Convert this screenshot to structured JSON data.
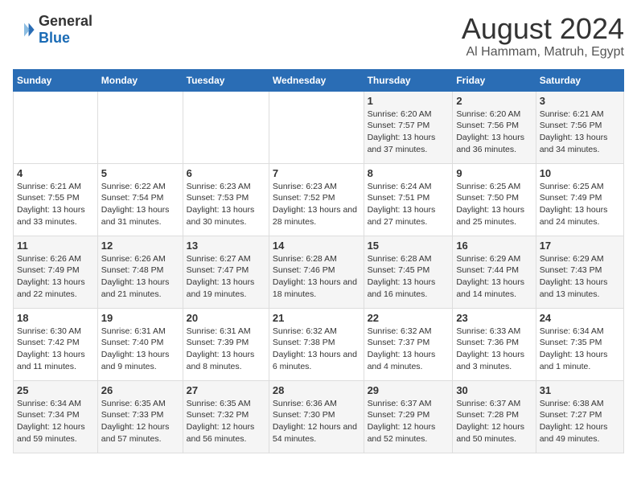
{
  "header": {
    "logo_general": "General",
    "logo_blue": "Blue",
    "main_title": "August 2024",
    "sub_title": "Al Hammam, Matruh, Egypt"
  },
  "days_of_week": [
    "Sunday",
    "Monday",
    "Tuesday",
    "Wednesday",
    "Thursday",
    "Friday",
    "Saturday"
  ],
  "weeks": [
    [
      {
        "day": "",
        "info": ""
      },
      {
        "day": "",
        "info": ""
      },
      {
        "day": "",
        "info": ""
      },
      {
        "day": "",
        "info": ""
      },
      {
        "day": "1",
        "info": "Sunrise: 6:20 AM\nSunset: 7:57 PM\nDaylight: 13 hours and 37 minutes."
      },
      {
        "day": "2",
        "info": "Sunrise: 6:20 AM\nSunset: 7:56 PM\nDaylight: 13 hours and 36 minutes."
      },
      {
        "day": "3",
        "info": "Sunrise: 6:21 AM\nSunset: 7:56 PM\nDaylight: 13 hours and 34 minutes."
      }
    ],
    [
      {
        "day": "4",
        "info": "Sunrise: 6:21 AM\nSunset: 7:55 PM\nDaylight: 13 hours and 33 minutes."
      },
      {
        "day": "5",
        "info": "Sunrise: 6:22 AM\nSunset: 7:54 PM\nDaylight: 13 hours and 31 minutes."
      },
      {
        "day": "6",
        "info": "Sunrise: 6:23 AM\nSunset: 7:53 PM\nDaylight: 13 hours and 30 minutes."
      },
      {
        "day": "7",
        "info": "Sunrise: 6:23 AM\nSunset: 7:52 PM\nDaylight: 13 hours and 28 minutes."
      },
      {
        "day": "8",
        "info": "Sunrise: 6:24 AM\nSunset: 7:51 PM\nDaylight: 13 hours and 27 minutes."
      },
      {
        "day": "9",
        "info": "Sunrise: 6:25 AM\nSunset: 7:50 PM\nDaylight: 13 hours and 25 minutes."
      },
      {
        "day": "10",
        "info": "Sunrise: 6:25 AM\nSunset: 7:49 PM\nDaylight: 13 hours and 24 minutes."
      }
    ],
    [
      {
        "day": "11",
        "info": "Sunrise: 6:26 AM\nSunset: 7:49 PM\nDaylight: 13 hours and 22 minutes."
      },
      {
        "day": "12",
        "info": "Sunrise: 6:26 AM\nSunset: 7:48 PM\nDaylight: 13 hours and 21 minutes."
      },
      {
        "day": "13",
        "info": "Sunrise: 6:27 AM\nSunset: 7:47 PM\nDaylight: 13 hours and 19 minutes."
      },
      {
        "day": "14",
        "info": "Sunrise: 6:28 AM\nSunset: 7:46 PM\nDaylight: 13 hours and 18 minutes."
      },
      {
        "day": "15",
        "info": "Sunrise: 6:28 AM\nSunset: 7:45 PM\nDaylight: 13 hours and 16 minutes."
      },
      {
        "day": "16",
        "info": "Sunrise: 6:29 AM\nSunset: 7:44 PM\nDaylight: 13 hours and 14 minutes."
      },
      {
        "day": "17",
        "info": "Sunrise: 6:29 AM\nSunset: 7:43 PM\nDaylight: 13 hours and 13 minutes."
      }
    ],
    [
      {
        "day": "18",
        "info": "Sunrise: 6:30 AM\nSunset: 7:42 PM\nDaylight: 13 hours and 11 minutes."
      },
      {
        "day": "19",
        "info": "Sunrise: 6:31 AM\nSunset: 7:40 PM\nDaylight: 13 hours and 9 minutes."
      },
      {
        "day": "20",
        "info": "Sunrise: 6:31 AM\nSunset: 7:39 PM\nDaylight: 13 hours and 8 minutes."
      },
      {
        "day": "21",
        "info": "Sunrise: 6:32 AM\nSunset: 7:38 PM\nDaylight: 13 hours and 6 minutes."
      },
      {
        "day": "22",
        "info": "Sunrise: 6:32 AM\nSunset: 7:37 PM\nDaylight: 13 hours and 4 minutes."
      },
      {
        "day": "23",
        "info": "Sunrise: 6:33 AM\nSunset: 7:36 PM\nDaylight: 13 hours and 3 minutes."
      },
      {
        "day": "24",
        "info": "Sunrise: 6:34 AM\nSunset: 7:35 PM\nDaylight: 13 hours and 1 minute."
      }
    ],
    [
      {
        "day": "25",
        "info": "Sunrise: 6:34 AM\nSunset: 7:34 PM\nDaylight: 12 hours and 59 minutes."
      },
      {
        "day": "26",
        "info": "Sunrise: 6:35 AM\nSunset: 7:33 PM\nDaylight: 12 hours and 57 minutes."
      },
      {
        "day": "27",
        "info": "Sunrise: 6:35 AM\nSunset: 7:32 PM\nDaylight: 12 hours and 56 minutes."
      },
      {
        "day": "28",
        "info": "Sunrise: 6:36 AM\nSunset: 7:30 PM\nDaylight: 12 hours and 54 minutes."
      },
      {
        "day": "29",
        "info": "Sunrise: 6:37 AM\nSunset: 7:29 PM\nDaylight: 12 hours and 52 minutes."
      },
      {
        "day": "30",
        "info": "Sunrise: 6:37 AM\nSunset: 7:28 PM\nDaylight: 12 hours and 50 minutes."
      },
      {
        "day": "31",
        "info": "Sunrise: 6:38 AM\nSunset: 7:27 PM\nDaylight: 12 hours and 49 minutes."
      }
    ]
  ]
}
